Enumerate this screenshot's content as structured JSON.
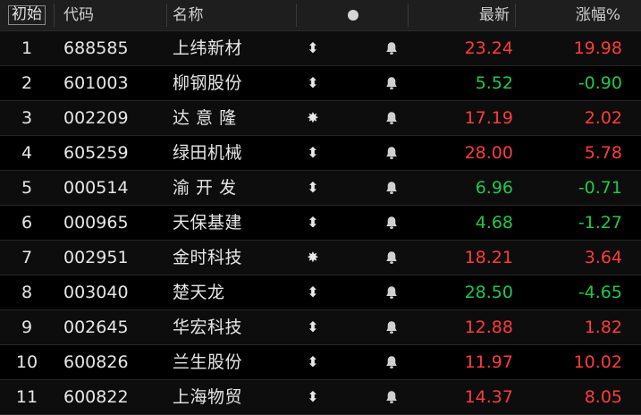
{
  "header": {
    "tag": "初始",
    "code": "代码",
    "name": "名称",
    "price": "最新",
    "change": "涨幅%"
  },
  "colors": {
    "up": "#ff3b3b",
    "down": "#1fc94a",
    "header_bg": "#1e1e1e",
    "row_bg": "#000000"
  },
  "rows": [
    {
      "idx": "1",
      "code": "688585",
      "name": "上纬新材",
      "signal": "updown-arrow-icon",
      "signal_glyph": "⬍",
      "price": "23.24",
      "change": "19.98",
      "dir": "up"
    },
    {
      "idx": "2",
      "code": "601003",
      "name": "柳钢股份",
      "signal": "updown-arrow-icon",
      "signal_glyph": "⬍",
      "price": "5.52",
      "change": "-0.90",
      "dir": "down"
    },
    {
      "idx": "3",
      "code": "002209",
      "name": "达 意 隆",
      "signal": "sparkle-icon",
      "signal_glyph": "✸",
      "price": "17.19",
      "change": "2.02",
      "dir": "up"
    },
    {
      "idx": "4",
      "code": "605259",
      "name": "绿田机械",
      "signal": "updown-arrow-icon",
      "signal_glyph": "⬍",
      "price": "28.00",
      "change": "5.78",
      "dir": "up"
    },
    {
      "idx": "5",
      "code": "000514",
      "name": "渝 开 发",
      "signal": "updown-arrow-icon",
      "signal_glyph": "⬍",
      "price": "6.96",
      "change": "-0.71",
      "dir": "down"
    },
    {
      "idx": "6",
      "code": "000965",
      "name": "天保基建",
      "signal": "updown-arrow-icon",
      "signal_glyph": "⬍",
      "price": "4.68",
      "change": "-1.27",
      "dir": "down"
    },
    {
      "idx": "7",
      "code": "002951",
      "name": "金时科技",
      "signal": "sparkle-icon",
      "signal_glyph": "✸",
      "price": "18.21",
      "change": "3.64",
      "dir": "up"
    },
    {
      "idx": "8",
      "code": "003040",
      "name": "楚天龙",
      "signal": "updown-arrow-icon",
      "signal_glyph": "⬍",
      "price": "28.50",
      "change": "-4.65",
      "dir": "down"
    },
    {
      "idx": "9",
      "code": "002645",
      "name": "华宏科技",
      "signal": "updown-arrow-icon",
      "signal_glyph": "⬍",
      "price": "12.88",
      "change": "1.82",
      "dir": "up"
    },
    {
      "idx": "10",
      "code": "600826",
      "name": "兰生股份",
      "signal": "updown-arrow-icon",
      "signal_glyph": "⬍",
      "price": "11.97",
      "change": "10.02",
      "dir": "up"
    },
    {
      "idx": "11",
      "code": "600822",
      "name": "上海物贸",
      "signal": "updown-arrow-icon",
      "signal_glyph": "⬍",
      "price": "14.37",
      "change": "8.05",
      "dir": "up"
    }
  ]
}
